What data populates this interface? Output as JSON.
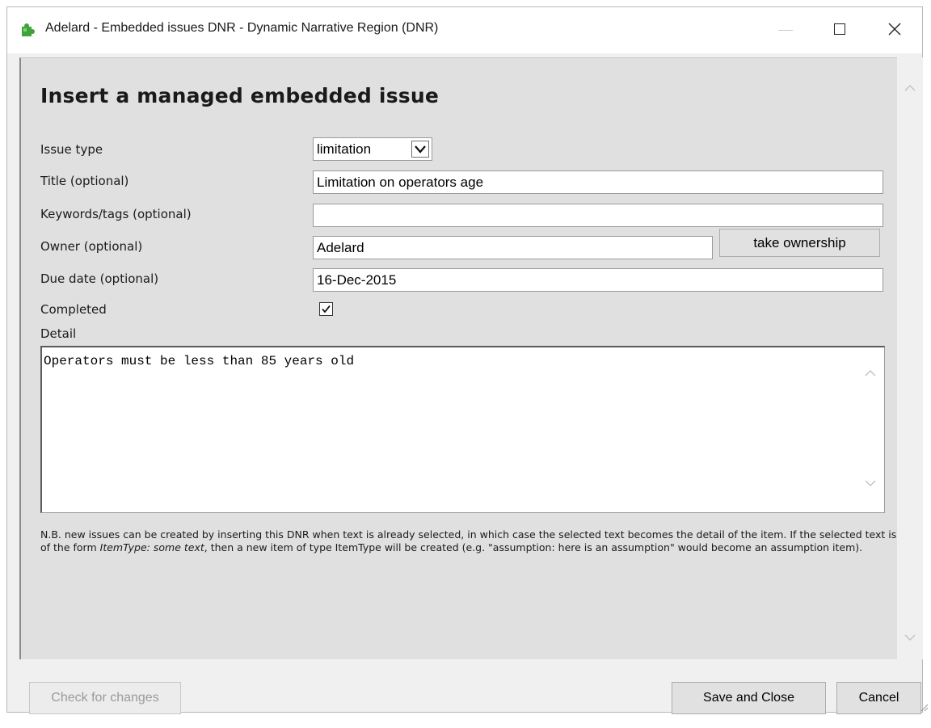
{
  "window": {
    "title": "Adelard - Embedded issues DNR - Dynamic Narrative Region (DNR)"
  },
  "form": {
    "heading": "Insert a managed embedded issue",
    "issue_type": {
      "label": "Issue type",
      "value": "limitation"
    },
    "title": {
      "label": "Title (optional)",
      "value": "Limitation on operators age"
    },
    "keywords": {
      "label": "Keywords/tags (optional)",
      "value": ""
    },
    "owner": {
      "label": "Owner (optional)",
      "value": "Adelard",
      "button_label": "take ownership"
    },
    "due_date": {
      "label": "Due date (optional)",
      "value": "16-Dec-2015"
    },
    "completed": {
      "label": "Completed",
      "checked": true
    },
    "detail": {
      "label": "Detail",
      "value": "Operators must be less than 85 years old"
    },
    "note": {
      "part1": "N.B. new issues can be created by inserting this DNR when text is already selected, in which case the selected text becomes the detail of the item. If the selected text is of the form ",
      "italic": "ItemType: some text",
      "part2": ", then a new item of type ItemType will be created (e.g. \"assumption: here is an assumption\" would become an assumption item)."
    }
  },
  "buttons": {
    "check_label": "Check for changes",
    "save_label": "Save and Close",
    "cancel_label": "Cancel"
  }
}
